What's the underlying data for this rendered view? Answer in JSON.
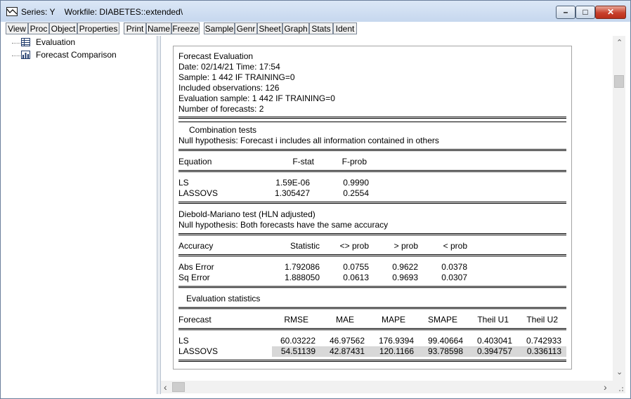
{
  "window": {
    "title": "Series: Y    Workfile: DIABETES::extended\\",
    "min_glyph": "–",
    "max_glyph": "□",
    "close_glyph": "✕"
  },
  "toolbar": [
    "View",
    "Proc",
    "Object",
    "Properties",
    "Print",
    "Name",
    "Freeze",
    "Sample",
    "Genr",
    "Sheet",
    "Graph",
    "Stats",
    "Ident"
  ],
  "tree": [
    {
      "label": "Evaluation",
      "icon": "table-icon"
    },
    {
      "label": "Forecast Comparison",
      "icon": "chart-icon"
    }
  ],
  "report": {
    "header": [
      "Forecast Evaluation",
      "Date: 02/14/21   Time: 17:54",
      "Sample: 1 442 IF TRAINING=0",
      "Included observations: 126",
      "Evaluation sample: 1 442 IF TRAINING=0",
      "Number of forecasts: 2"
    ],
    "combination": {
      "title": "Combination tests",
      "null": "Null hypothesis: Forecast i includes all information contained in others",
      "columns": [
        "Equation",
        "F-stat",
        "F-prob"
      ],
      "rows": [
        [
          "LS",
          "1.59E-06",
          "0.9990"
        ],
        [
          "LASSOVS",
          "1.305427",
          "0.2554"
        ]
      ]
    },
    "dm": {
      "title": "Diebold-Mariano test (HLN adjusted)",
      "null": "Null hypothesis: Both forecasts have the same accuracy",
      "columns": [
        "Accuracy",
        "Statistic",
        "<> prob",
        "> prob",
        "< prob"
      ],
      "rows": [
        [
          "Abs Error",
          "1.792086",
          "0.0755",
          "0.9622",
          "0.0378"
        ],
        [
          "Sq Error",
          "1.888050",
          "0.0613",
          "0.9693",
          "0.0307"
        ]
      ]
    },
    "eval": {
      "title": "Evaluation statistics",
      "columns": [
        "Forecast",
        "RMSE",
        "MAE",
        "MAPE",
        "SMAPE",
        "Theil U1",
        "Theil U2"
      ],
      "rows": [
        [
          "LS",
          "60.03222",
          "46.97562",
          "176.9394",
          "99.40664",
          "0.403041",
          "0.742933"
        ],
        [
          "LASSOVS",
          "54.51139",
          "42.87431",
          "120.1166",
          "93.78598",
          "0.394757",
          "0.336113"
        ]
      ]
    }
  },
  "scroll": {
    "up": "⌃",
    "down": "⌄",
    "left": "‹",
    "right": "›"
  }
}
